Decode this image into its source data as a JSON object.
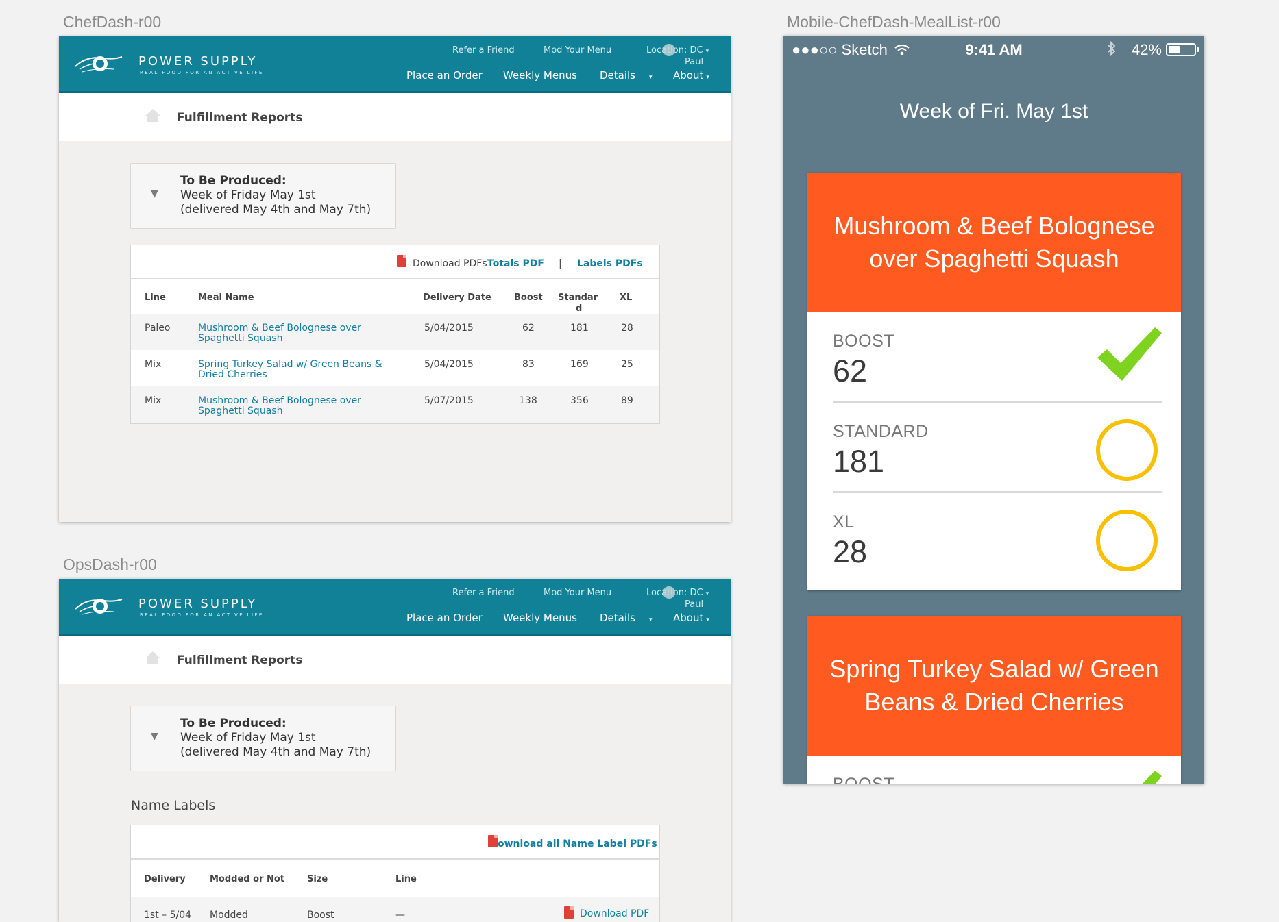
{
  "artboards": {
    "chef": "ChefDash-r00",
    "ops": "OpsDash-r00",
    "mobile": "Mobile-ChefDash-MealList-r00"
  },
  "header": {
    "brand": "POWER SUPPLY",
    "tagline": "REAL FOOD FOR AN ACTIVE LIFE",
    "util_links": [
      "Refer a Friend",
      "Mod Your Menu"
    ],
    "location_line1": "Location: DC",
    "location_line2": "Paul",
    "nav": [
      "Place an Order",
      "Weekly Menus",
      "Details",
      "About"
    ]
  },
  "page_title": "Fulfillment Reports",
  "produced": {
    "heading": "To Be Produced:",
    "week": "Week of Friday May 1st",
    "delivered": "(delivered May 4th and May 7th)"
  },
  "chef_table": {
    "download_label": "Download PDFs",
    "totals_link": "Totals PDF",
    "separator": "|",
    "labels_link": "Labels PDFs",
    "columns": [
      "Line",
      "Meal Name",
      "Delivery Date",
      "Boost",
      "Standar",
      "d",
      "XL"
    ],
    "rows": [
      {
        "line": "Paleo",
        "meal1": "Mushroom & Beef Bolognese over",
        "meal2": "Spaghetti Squash",
        "date": "5/04/2015",
        "boost": "62",
        "standard": "181",
        "xl": "28"
      },
      {
        "line": "Mix",
        "meal1": "Spring Turkey Salad w/ Green Beans &",
        "meal2": "Dried Cherries",
        "date": "5/04/2015",
        "boost": "83",
        "standard": "169",
        "xl": "25"
      },
      {
        "line": "Mix",
        "meal1": "Mushroom & Beef Bolognese over",
        "meal2": "Spaghetti Squash",
        "date": "5/07/2015",
        "boost": "138",
        "standard": "356",
        "xl": "89"
      }
    ]
  },
  "ops": {
    "section_label": "Name Labels",
    "download_all": "ownload all Name Label PDFs",
    "columns": [
      "Delivery",
      "Modded or Not",
      "Size",
      "Line"
    ],
    "rows": [
      {
        "delivery": "1st – 5/04",
        "modded": "Modded",
        "size": "Boost",
        "line": "—",
        "action": "Download PDF"
      }
    ]
  },
  "mobile": {
    "carrier": "●●●○○ Sketch",
    "time": "9:41 AM",
    "battery": "42%",
    "week_title": "Week of Fri. May 1st",
    "meals": [
      {
        "name": "Mushroom & Beef Bolognese over Spaghetti Squash",
        "sizes": [
          {
            "label": "BOOST",
            "value": "62",
            "status": "done"
          },
          {
            "label": "STANDARD",
            "value": "181",
            "status": "pending"
          },
          {
            "label": "XL",
            "value": "28",
            "status": "pending"
          }
        ]
      },
      {
        "name": "Spring Turkey Salad w/ Green Beans & Dried Cherries",
        "sizes": [
          {
            "label": "BOOST",
            "value": "",
            "status": "done"
          }
        ]
      }
    ]
  },
  "colors": {
    "header_teal": "#118198",
    "link_blue": "#127fa0",
    "meal_orange": "#ff5a1f",
    "check_green": "#7ed321",
    "pending_yellow": "#f7c000",
    "phone_bg": "#5f7b89"
  },
  "icons": [
    "home-icon",
    "pdf-icon",
    "check-icon",
    "circle-icon",
    "wifi-icon",
    "bluetooth-icon",
    "battery-icon",
    "caret-down-icon",
    "triangle-down-icon"
  ]
}
